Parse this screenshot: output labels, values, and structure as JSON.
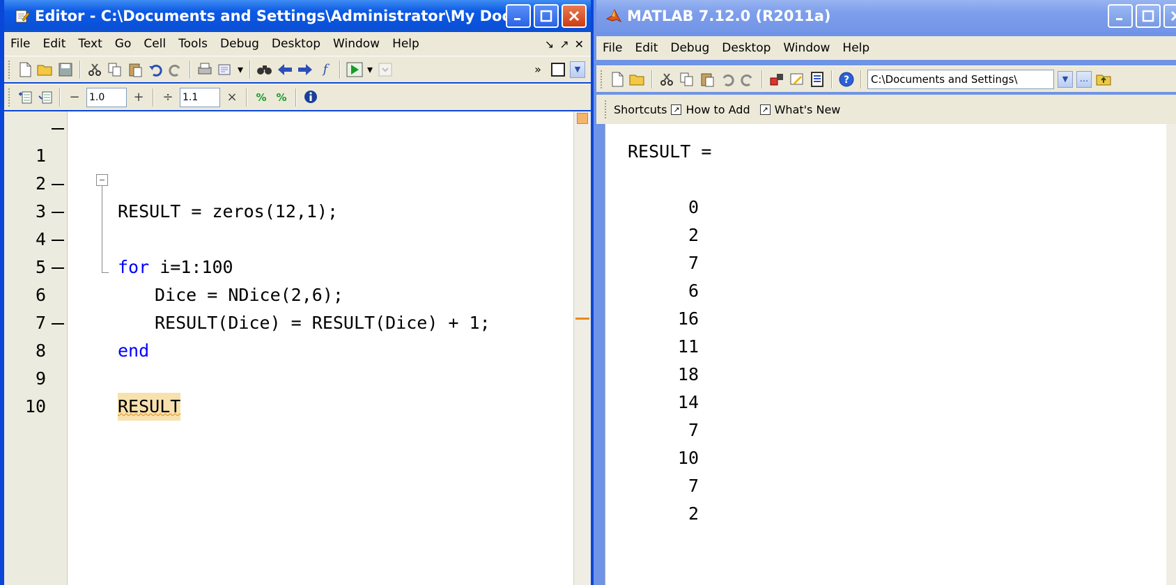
{
  "editor": {
    "title": "Editor - C:\\Documents and Settings\\Administrator\\My Documen...",
    "menu": [
      "File",
      "Edit",
      "Text",
      "Go",
      "Cell",
      "Tools",
      "Debug",
      "Desktop",
      "Window",
      "Help"
    ],
    "cell_toolbar": {
      "minus": "−",
      "value1": "1.0",
      "plus": "+",
      "divide": "÷",
      "value2": "1.1",
      "times": "×"
    },
    "line_numbers": [
      "1",
      "2",
      "3",
      "4",
      "5",
      "6",
      "7",
      "8",
      "9",
      "10"
    ],
    "code": {
      "line1": "RESULT = zeros(12,1);",
      "line3_kw": "for",
      "line3_rest": " i=1:100",
      "line4": "Dice = NDice(2,6);",
      "line5": "RESULT(Dice) = RESULT(Dice) + 1;",
      "line6_kw": "end",
      "line8": "RESULT"
    }
  },
  "matlab": {
    "title": "MATLAB  7.12.0 (R2011a)",
    "menu": [
      "File",
      "Edit",
      "Debug",
      "Desktop",
      "Window",
      "Help"
    ],
    "current_folder": "C:\\Documents and Settings\\",
    "shortcuts": {
      "label": "Shortcuts",
      "how_to_add": "How to Add",
      "whats_new": "What's New"
    },
    "output_header": "RESULT =",
    "output_values": [
      "0",
      "2",
      "7",
      "6",
      "16",
      "11",
      "18",
      "14",
      "7",
      "10",
      "7",
      "2"
    ]
  },
  "colors": {
    "keyword": "#0000ff",
    "title_active": "#0a53dd",
    "title_inactive": "#7395e6",
    "highlight": "#f7e1ad"
  }
}
